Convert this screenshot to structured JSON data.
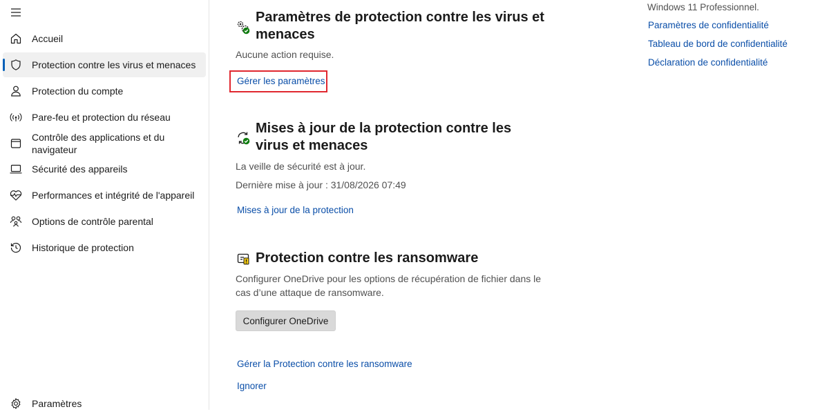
{
  "sidebar": {
    "menu_icon": "hamburger-menu-icon",
    "items": [
      {
        "label": "Accueil",
        "icon": "home-icon"
      },
      {
        "label": "Protection contre les virus et menaces",
        "icon": "shield-icon",
        "selected": true
      },
      {
        "label": "Protection du compte",
        "icon": "person-icon"
      },
      {
        "label": "Pare-feu et protection du réseau",
        "icon": "wireless-signal-icon"
      },
      {
        "label": "Contrôle des applications et du navigateur",
        "icon": "app-window-icon"
      },
      {
        "label": "Sécurité des appareils",
        "icon": "laptop-icon"
      },
      {
        "label": "Performances et intégrité de l'appareil",
        "icon": "heart-pulse-icon"
      },
      {
        "label": "Options de contrôle parental",
        "icon": "family-icon"
      },
      {
        "label": "Historique de protection",
        "icon": "history-icon"
      }
    ],
    "settings": {
      "label": "Paramètres",
      "icon": "gear-icon"
    }
  },
  "main": {
    "settings_section": {
      "icon": "gears-check-icon",
      "title": "Paramètres de protection contre les virus et menaces",
      "status": "Aucune action requise.",
      "link": "Gérer les paramètres"
    },
    "updates_section": {
      "icon": "refresh-check-icon",
      "title": "Mises à jour de la protection contre les virus et menaces",
      "status": "La veille de sécurité est à jour.",
      "last_update": "Dernière mise à jour : 31/08/2026 07:49",
      "link": "Mises à jour de la protection"
    },
    "ransomware_section": {
      "icon": "ransomware-folder-icon",
      "title": "Protection contre les ransomware",
      "description": "Configurer OneDrive pour les options de récupération de fichier dans le cas d’une attaque de ransomware.",
      "button": "Configurer OneDrive",
      "manage_link": "Gérer la Protection contre les ransomware",
      "ignore_link": "Ignorer"
    }
  },
  "right_panel": {
    "edition": "Windows 11 Professionnel.",
    "links": [
      "Paramètres de confidentialité",
      "Tableau de bord de confidentialité",
      "Déclaration de confidentialité"
    ]
  },
  "colors": {
    "accent": "#005fb8",
    "link": "#0a4ea8",
    "highlight_box": "#e0262e",
    "check_green": "#107c10",
    "warning_yellow": "#f2c80f"
  }
}
